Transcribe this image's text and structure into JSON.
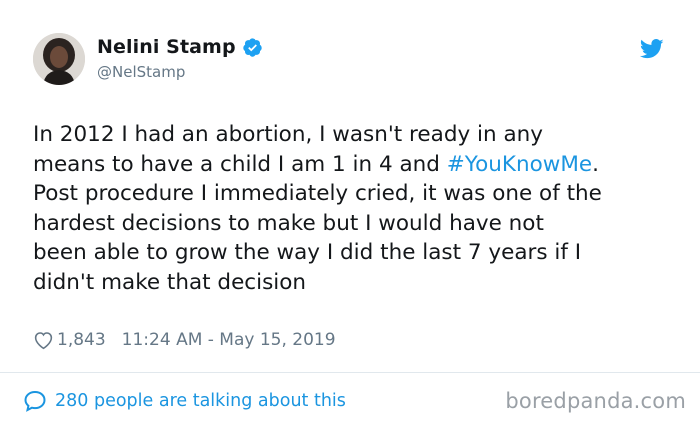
{
  "user": {
    "display_name": "Nelini Stamp",
    "handle": "@NelStamp",
    "verified": true
  },
  "tweet": {
    "text_before": "In 2012 I had an abortion, I wasn't ready in any\nmeans to have a child I am 1 in 4 and ",
    "hashtag": "#YouKnowMe",
    "text_after": ".\nPost procedure I immediately cried, it was one of the\nhardest decisions to make but I would have not\nbeen able to grow the way I did the last 7 years if I\ndidn't make that decision"
  },
  "meta": {
    "like_count": "1,843",
    "timestamp": "11:24 AM - May 15, 2019"
  },
  "footer": {
    "talking_text": "280 people are talking about this"
  },
  "watermark": "boredpanda.com",
  "colors": {
    "link_blue": "#1b95e0",
    "secondary_gray": "#657786",
    "text_dark": "#14171a"
  },
  "icons": {
    "verified": "verified-badge-icon",
    "brand": "twitter-bird-icon",
    "like": "heart-icon",
    "conversation": "speech-bubble-icon"
  }
}
